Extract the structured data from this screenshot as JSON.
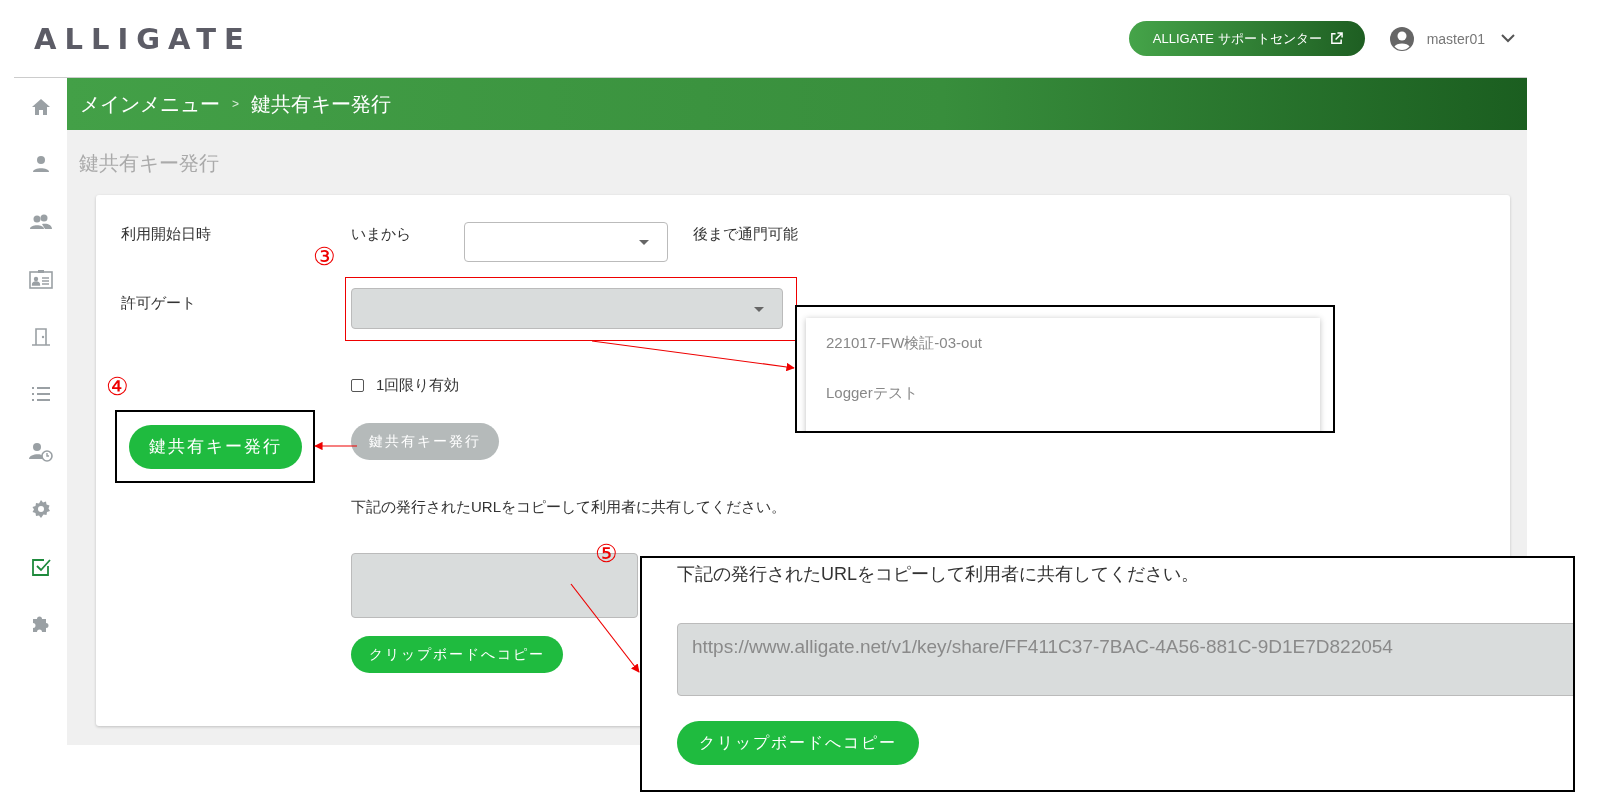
{
  "header": {
    "logo": "ALLIGATE",
    "support_button": "ALLIGATE サポートセンター",
    "user": "master01"
  },
  "sidebar": {
    "items": [
      {
        "kind": "home",
        "selected": false
      },
      {
        "kind": "user",
        "selected": false
      },
      {
        "kind": "users",
        "selected": false
      },
      {
        "kind": "card",
        "selected": false
      },
      {
        "kind": "door",
        "selected": false
      },
      {
        "kind": "list",
        "selected": false
      },
      {
        "kind": "user-clock",
        "selected": false
      },
      {
        "kind": "gear",
        "selected": false
      },
      {
        "kind": "check",
        "selected": true
      },
      {
        "kind": "puzzle",
        "selected": false
      }
    ]
  },
  "breadcrumb": {
    "items": [
      "メインメニュー",
      "鍵共有キー発行"
    ],
    "separator": ">"
  },
  "page_title": "鍵共有キー発行",
  "form": {
    "start_label": "利用開始日時",
    "start_prefix": "いまから",
    "start_suffix": "後まで通門可能",
    "gate_label": "許可ゲート",
    "once_label": "1回限り有効",
    "once_checked": false,
    "issue_button": {
      "label": "鍵共有キー発行",
      "disabled": true
    },
    "instruction": "下記の発行されたURLをコピーして利用者に共有してください。",
    "copy_button": "クリップボードへコピー"
  },
  "annotations": {
    "markers": [
      "③",
      "④",
      "⑤"
    ],
    "gate_options": [
      "221017-FW検証-03-out",
      "Loggerテスト"
    ],
    "issue_button": {
      "label": "鍵共有キー発行",
      "disabled": false
    },
    "url_panel": {
      "instruction": "下記の発行されたURLをコピーして利用者に共有してください。",
      "url": "https://www.alligate.net/v1/key/share/FF411C37-7BAC-4A56-881C-9D1E7D822054",
      "copy_button": "クリップボードへコピー"
    }
  }
}
